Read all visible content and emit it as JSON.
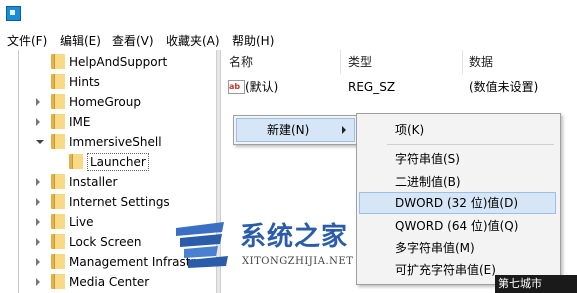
{
  "menu": [
    "文件(F)",
    "编辑(E)",
    "查看(V)",
    "收藏夹(A)",
    "帮助(H)"
  ],
  "tree": {
    "items": [
      {
        "label": "HelpAndSupport",
        "expander": "none"
      },
      {
        "label": "Hints",
        "expander": "none"
      },
      {
        "label": "HomeGroup",
        "expander": "closed"
      },
      {
        "label": "IME",
        "expander": "closed"
      },
      {
        "label": "ImmersiveShell",
        "expander": "open"
      },
      {
        "label": "Launcher",
        "expander": "none",
        "selected": true,
        "child": true
      },
      {
        "label": "Installer",
        "expander": "closed"
      },
      {
        "label": "Internet Settings",
        "expander": "closed"
      },
      {
        "label": "Live",
        "expander": "closed"
      },
      {
        "label": "Lock Screen",
        "expander": "closed"
      },
      {
        "label": "Management Infrastr",
        "expander": "closed"
      },
      {
        "label": "Media Center",
        "expander": "closed"
      }
    ]
  },
  "list": {
    "headers": [
      "名称",
      "类型",
      "数据"
    ],
    "rows": [
      {
        "icon": "ab",
        "name": "(默认)",
        "type": "REG_SZ",
        "data": "(数值未设置)"
      }
    ]
  },
  "context_menu": {
    "new_label": "新建(N)",
    "submenu": [
      "项(K)",
      "字符串值(S)",
      "二进制值(B)",
      "DWORD (32 位)值(D)",
      "QWORD (64 位)值(Q)",
      "多字符串值(M)",
      "可扩充字符串值(E)"
    ],
    "highlighted_index": 3
  },
  "watermark": {
    "title": "系统之家",
    "subtitle": "XITONGZHIJIA.NET",
    "corner": "第七城市"
  },
  "colors": {
    "highlight": "#d6e6f7",
    "folder": "#f8da85",
    "watermark": "#2a5caa"
  }
}
